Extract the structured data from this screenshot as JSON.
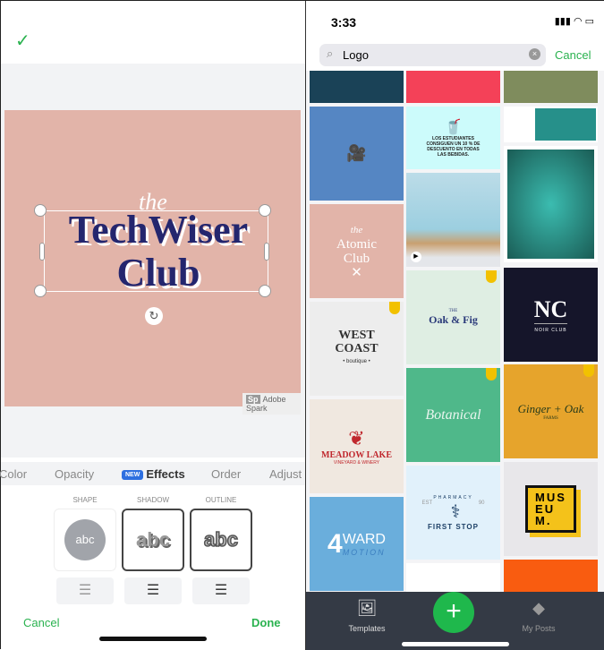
{
  "editor": {
    "canvas": {
      "the": "the",
      "line1": "TechWiser",
      "line2": "Club",
      "watermark_badge": "Sp",
      "watermark": "Adobe Spark"
    },
    "tabs": [
      "Color",
      "Opacity",
      "Effects",
      "Order",
      "Adjust"
    ],
    "new_badge": "NEW",
    "effects": [
      {
        "label": "SHAPE",
        "sample": "abc"
      },
      {
        "label": "SHADOW",
        "sample": "abc"
      },
      {
        "label": "OUTLINE",
        "sample": "abc"
      }
    ],
    "cancel": "Cancel",
    "done": "Done",
    "accent": "#2ab24f"
  },
  "browser": {
    "time": "3:33",
    "search_value": "Logo",
    "cancel": "Cancel",
    "tiles": {
      "atomic_the": "the",
      "atomic": "Atomic",
      "atomic_club": "Club",
      "drinks": "LOS ESTUDIANTES CONSIGUEN UN 10 % DE DESCUENTO EN TODAS LAS BEBIDAS.",
      "west": "WEST",
      "coast": "COAST",
      "boutique": "• boutique •",
      "oak_the": "THE",
      "oak": "Oak & Fig",
      "nc": "NC",
      "noir": "NOIR CLUB",
      "botanical": "Botanical",
      "ginger": "Ginger + Oak",
      "farms": "FARMS",
      "meadow": "MEADOW LAKE",
      "vineyard": "VINEYARD & WINERY",
      "pharmacy": "PHARMACY",
      "est": "EST",
      "year": "90",
      "firststop": "FIRST STOP",
      "four": "4",
      "ward": "WARD",
      "motion": "MOTION",
      "museum": [
        "MUS",
        "EU",
        "M."
      ]
    },
    "nav": {
      "templates": "Templates",
      "my_posts": "My Posts"
    }
  }
}
